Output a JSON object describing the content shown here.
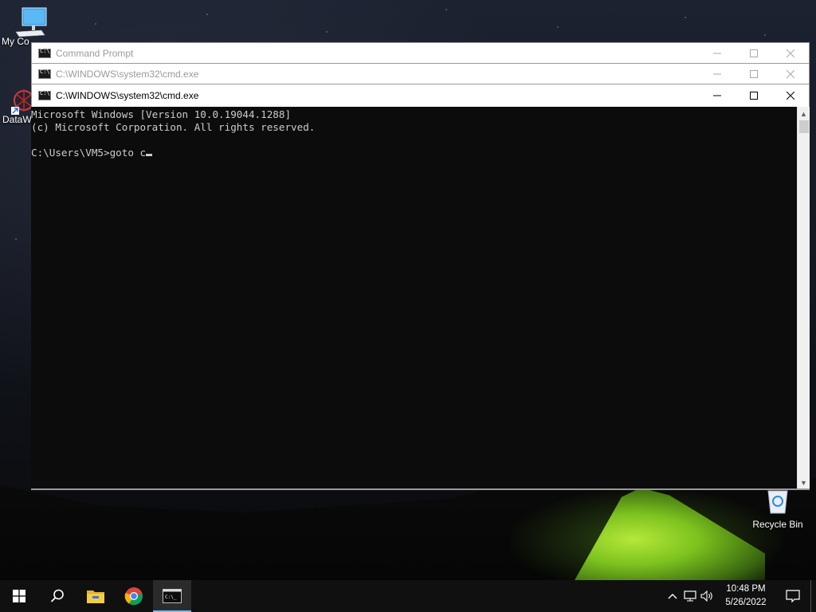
{
  "desktop": {
    "icons": [
      {
        "label": "My Co"
      },
      {
        "label": "DataW"
      },
      {
        "label": "Recycle Bin"
      }
    ]
  },
  "windows": [
    {
      "title": "Command Prompt",
      "state": "inactive"
    },
    {
      "title": "C:\\WINDOWS\\system32\\cmd.exe",
      "state": "inactive"
    },
    {
      "title": "C:\\WINDOWS\\system32\\cmd.exe",
      "state": "active"
    }
  ],
  "console": {
    "lines": [
      "Microsoft Windows [Version 10.0.19044.1288]",
      "(c) Microsoft Corporation. All rights reserved.",
      "",
      "C:\\Users\\VM5>goto c"
    ]
  },
  "taskbar": {
    "items": [
      {
        "icon": "windows-start-icon"
      },
      {
        "icon": "search-icon"
      },
      {
        "icon": "file-explorer-icon"
      },
      {
        "icon": "chrome-icon"
      },
      {
        "icon": "cmd-icon",
        "active": true
      }
    ],
    "tray": {
      "icons": [
        "chevron-up-icon",
        "network-icon",
        "volume-icon"
      ],
      "time": "10:48 PM",
      "date": "5/26/2022"
    }
  },
  "colors": {
    "console_bg": "#0c0c0c",
    "console_fg": "#cccccc",
    "taskbar_bg": "#101010",
    "accent": "#76b9ed"
  }
}
